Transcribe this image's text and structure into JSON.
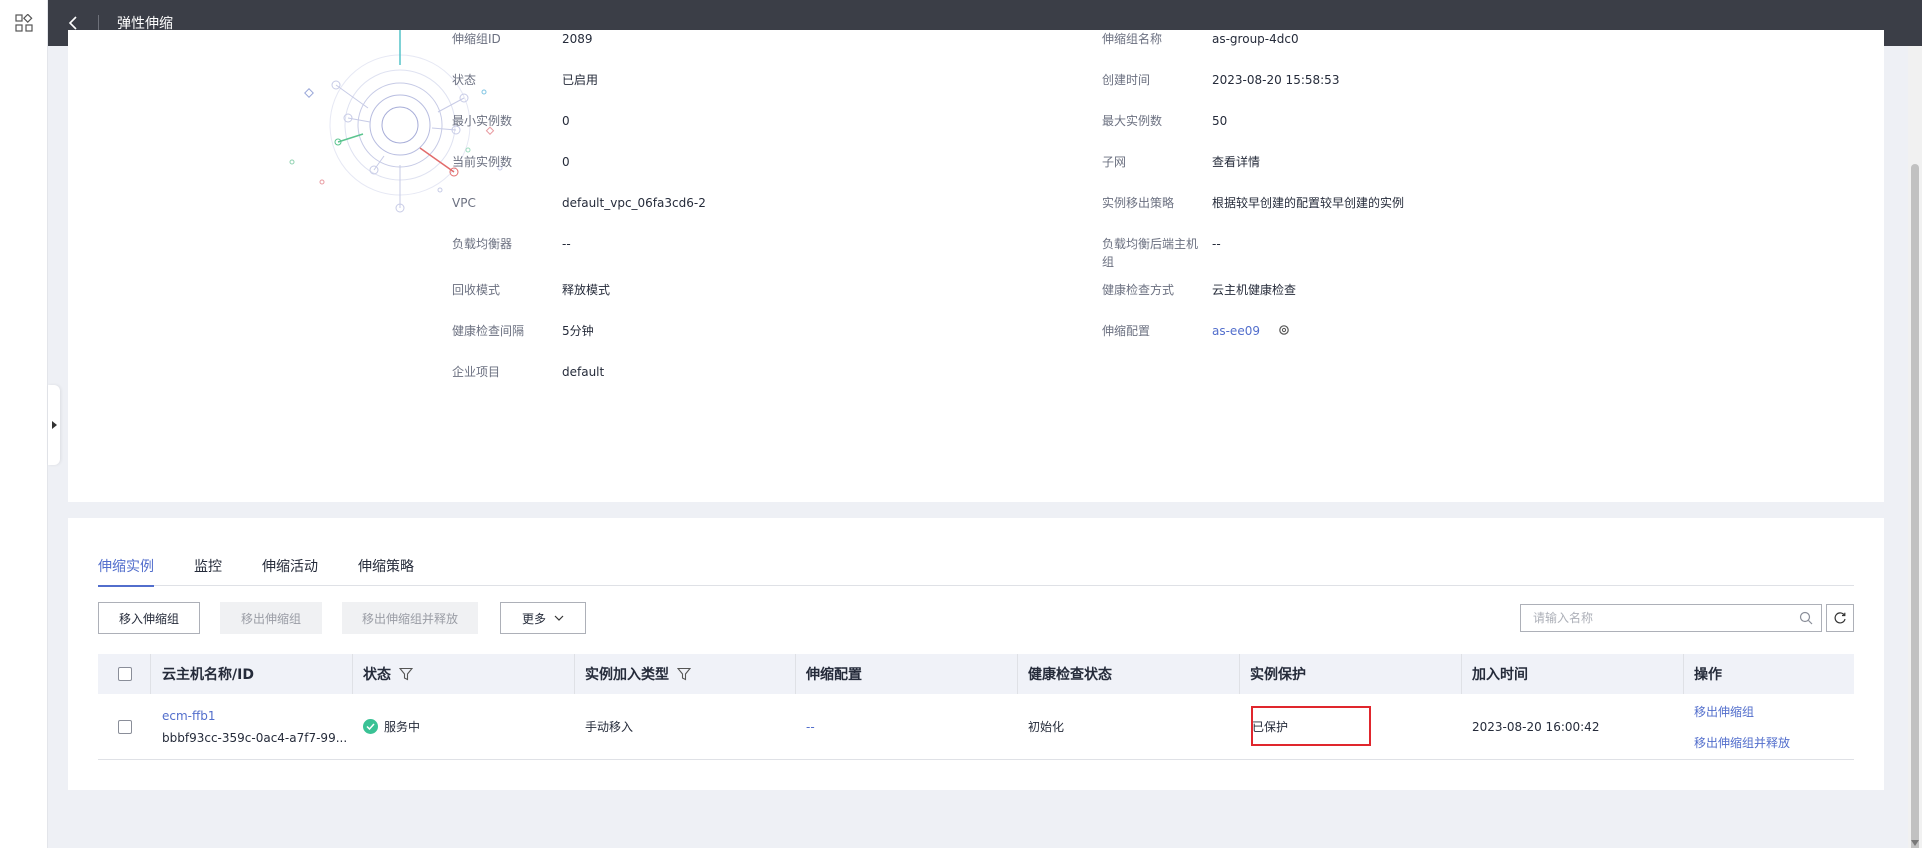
{
  "header": {
    "title": "弹性伸缩"
  },
  "info": {
    "rows_left": [
      {
        "label": "伸缩组ID",
        "value": "2089",
        "link": false
      },
      {
        "label": "状态",
        "value": "已启用",
        "link": false
      },
      {
        "label": "最小实例数",
        "value": "0",
        "link": false
      },
      {
        "label": "当前实例数",
        "value": "0",
        "link": false
      },
      {
        "label": "VPC",
        "value": "default_vpc_06fa3cd6-2",
        "link": true
      },
      {
        "label": "负载均衡器",
        "value": "--",
        "link": false
      },
      {
        "label": "回收模式",
        "value": "释放模式",
        "link": false
      },
      {
        "label": "健康检查间隔",
        "value": "5分钟",
        "link": false
      },
      {
        "label": "企业项目",
        "value": "default",
        "link": false
      }
    ],
    "rows_right": [
      {
        "label": "伸缩组名称",
        "value": "as-group-4dc0",
        "link": false
      },
      {
        "label": "创建时间",
        "value": "2023-08-20 15:58:53",
        "link": false
      },
      {
        "label": "最大实例数",
        "value": "50",
        "link": false
      },
      {
        "label": "子网",
        "value": "查看详情",
        "link": true
      },
      {
        "label": "实例移出策略",
        "value": "根据较早创建的配置较早创建的实例",
        "link": false
      },
      {
        "label": "负载均衡后端主机组",
        "value": "--",
        "link": false
      },
      {
        "label": "健康检查方式",
        "value": "云主机健康检查",
        "link": false
      },
      {
        "label": "伸缩配置",
        "value": "as-ee09",
        "link": true
      },
      {
        "label": "",
        "value": "",
        "link": false
      }
    ]
  },
  "tabs": [
    {
      "label": "伸缩实例",
      "active": true
    },
    {
      "label": "监控",
      "active": false
    },
    {
      "label": "伸缩活动",
      "active": false
    },
    {
      "label": "伸缩策略",
      "active": false
    }
  ],
  "toolbar": {
    "add_label": "移入伸缩组",
    "remove_label": "移出伸缩组",
    "remove_release_label": "移出伸缩组并释放",
    "more_label": "更多",
    "search_placeholder": "请输入名称"
  },
  "table": {
    "headers": {
      "name": "云主机名称/ID",
      "status": "状态",
      "join_type": "实例加入类型",
      "config": "伸缩配置",
      "health": "健康检查状态",
      "protect": "实例保护",
      "join_time": "加入时间",
      "ops": "操作"
    },
    "rows": [
      {
        "name": "ecm-ffb1",
        "id": "bbbf93cc-359c-0ac4-a7f7-99...",
        "status": "服务中",
        "join_type": "手动移入",
        "config": "--",
        "health": "初始化",
        "protect": "已保护",
        "join_time": "2023-08-20 16:00:42",
        "op1": "移出伸缩组",
        "op2": "移出伸缩组并释放"
      }
    ]
  },
  "colors": {
    "accent": "#526ecc",
    "highlight": "#e0262d",
    "ok": "#3ac295",
    "topbar": "#3b3e47"
  }
}
